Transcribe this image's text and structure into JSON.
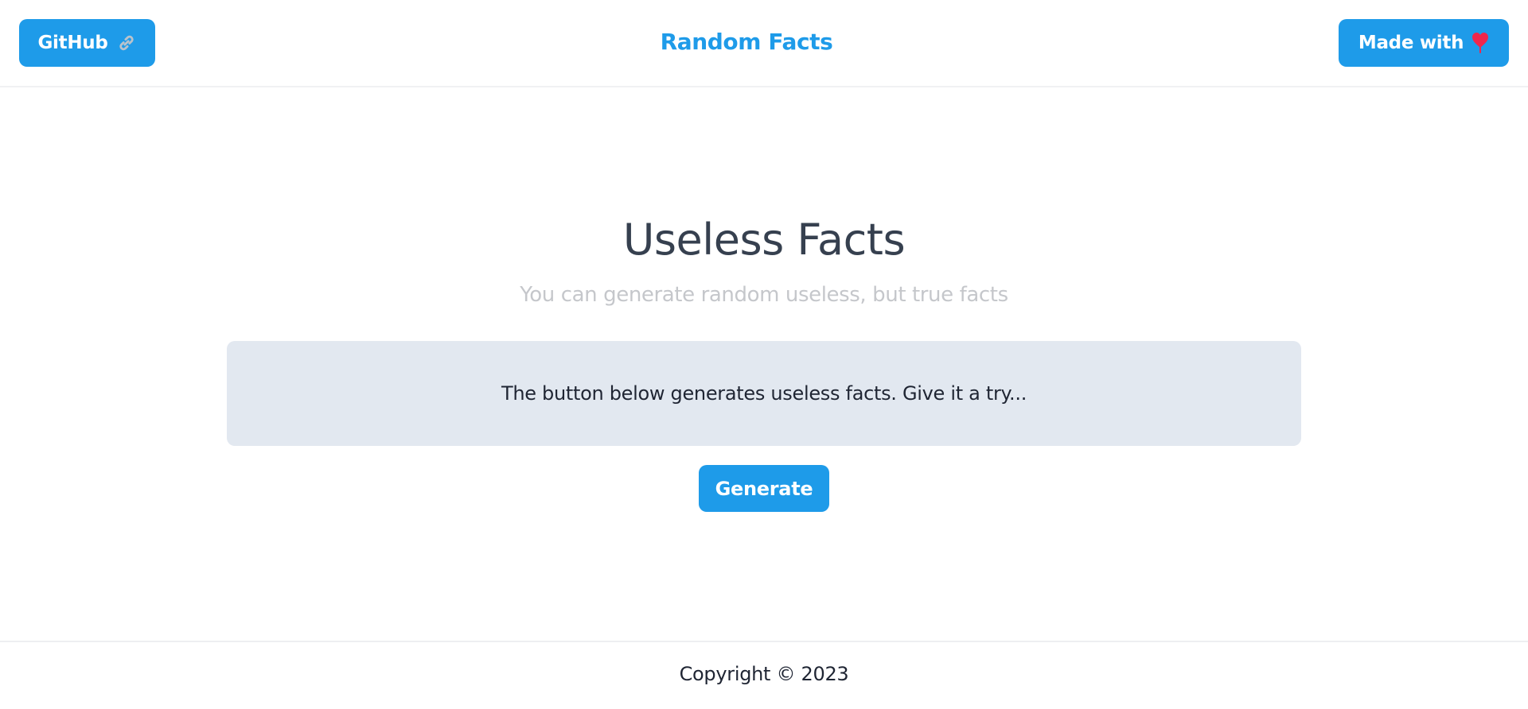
{
  "header": {
    "github_label": "GitHub",
    "github_icon": "link-icon",
    "brand_title": "Random Facts",
    "made_with_label": "Made with",
    "made_with_icon": "heart-icon"
  },
  "main": {
    "title": "Useless Facts",
    "subtitle": "You can generate random useless, but true facts",
    "fact_text": "The button below generates useless facts. Give it a try...",
    "generate_label": "Generate"
  },
  "footer": {
    "copyright": "Copyright © 2023"
  },
  "colors": {
    "accent": "#1e9be9",
    "fact_box_bg": "#e2e8f0",
    "title_text": "#36404f",
    "subtitle_text": "#c5c7cb",
    "heart": "#f0264c"
  }
}
